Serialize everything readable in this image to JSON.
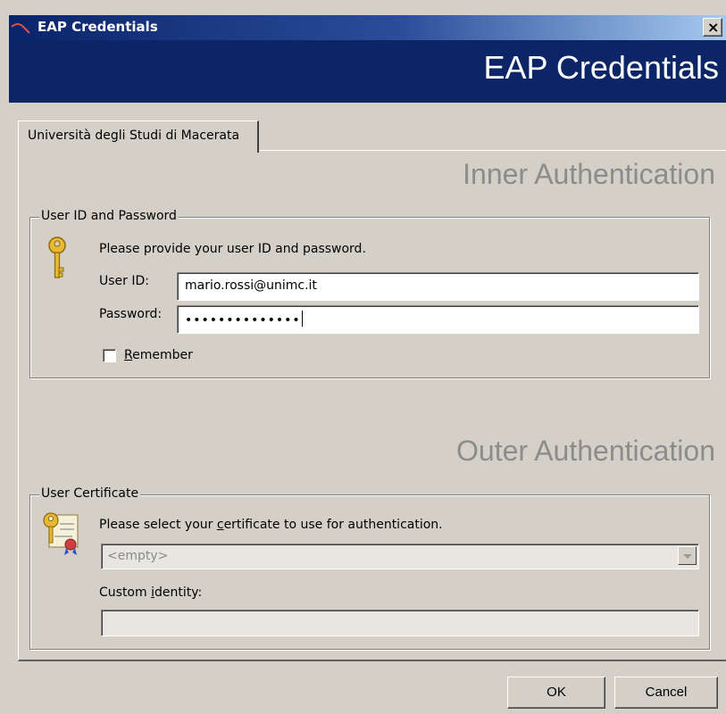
{
  "window": {
    "title": "EAP Credentials",
    "close_label": "×"
  },
  "banner": {
    "title": "EAP Credentials"
  },
  "tab": {
    "label": "Università degli Studi di Macerata"
  },
  "inner": {
    "heading": "Inner Authentication",
    "group_title": "User ID and Password",
    "prompt": "Please provide your user ID and password.",
    "user_label": "User ID:",
    "user_value": "mario.rossi@unimc.it",
    "password_label": "Password:",
    "password_value": "••••••••••••••",
    "remember_prefix": "R",
    "remember_rest": "emember",
    "remember_checked": false
  },
  "outer": {
    "heading": "Outer Authentication",
    "group_title": "User Certificate",
    "prompt_pre": "Please select your ",
    "prompt_accel": "c",
    "prompt_post": "ertificate to use for authentication.",
    "certificate_selected": "<empty>",
    "custom_label_pre": "Custom ",
    "custom_label_accel": "i",
    "custom_label_post": "dentity:",
    "custom_value": ""
  },
  "buttons": {
    "ok": "OK",
    "cancel": "Cancel"
  },
  "colors": {
    "banner": "#0c2566",
    "face": "#d4d0c8",
    "heading": "#8c8c8c"
  },
  "icons": {
    "logo": "eap-logo-icon",
    "key": "key-icon",
    "certificate": "certificate-icon"
  }
}
